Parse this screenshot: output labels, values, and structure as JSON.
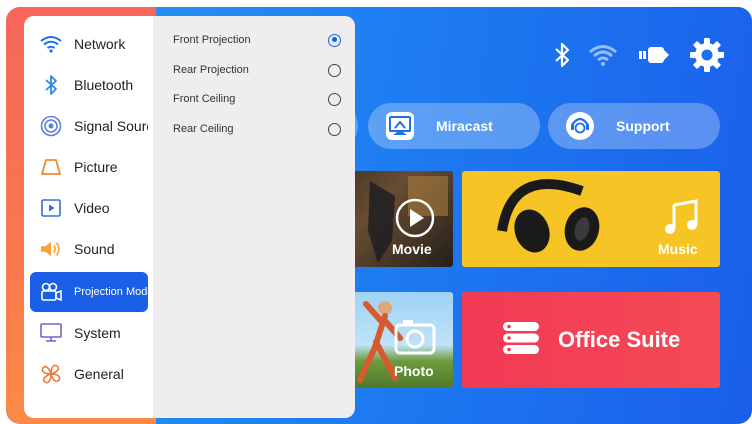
{
  "status": {
    "icons": [
      "bluetooth-icon",
      "wifi-icon",
      "input-source-icon",
      "settings-gear-icon"
    ]
  },
  "quick_buttons": [
    {
      "label": "Miracast",
      "icon": "miracast-icon"
    },
    {
      "label": "Support",
      "icon": "support-icon"
    }
  ],
  "tiles": {
    "movie": "Movie",
    "music": "Music",
    "photo": "Photo",
    "office": "Office Suite"
  },
  "sidebar": {
    "items": [
      {
        "label": "Network",
        "icon": "wifi-icon"
      },
      {
        "label": "Bluetooth",
        "icon": "bluetooth-icon"
      },
      {
        "label": "Signal Source",
        "icon": "signal-source-icon"
      },
      {
        "label": "Picture",
        "icon": "picture-icon"
      },
      {
        "label": "Video",
        "icon": "video-icon"
      },
      {
        "label": "Sound",
        "icon": "sound-icon"
      },
      {
        "label": "Projection Mode",
        "icon": "projector-icon"
      },
      {
        "label": "System",
        "icon": "monitor-icon"
      },
      {
        "label": "General",
        "icon": "general-icon"
      }
    ],
    "active_index": 6
  },
  "projection_options": [
    {
      "label": "Front Projection",
      "selected": true
    },
    {
      "label": "Rear Projection",
      "selected": false
    },
    {
      "label": "Front Ceiling",
      "selected": false
    },
    {
      "label": "Rear Ceiling",
      "selected": false
    }
  ],
  "colors": {
    "accent": "#1a5fe6",
    "background_blue": "#1e7ff2",
    "music_tile": "#f7c425",
    "office_tile": "#f23a55"
  }
}
